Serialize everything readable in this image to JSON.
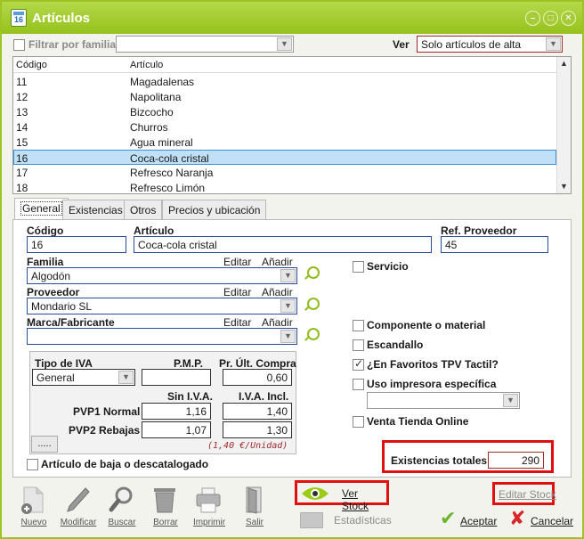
{
  "window": {
    "title": "Artículos",
    "icon_text": "16"
  },
  "filter": {
    "label": "Filtrar por familia",
    "value": "",
    "ver_label": "Ver",
    "ver_value": "Solo artículos de alta"
  },
  "list": {
    "columns": [
      "Código",
      "Artículo"
    ],
    "rows": [
      [
        "11",
        "Magadalenas"
      ],
      [
        "12",
        "Napolitana"
      ],
      [
        "13",
        "Bizcocho"
      ],
      [
        "14",
        "Churros"
      ],
      [
        "15",
        "Agua mineral"
      ],
      [
        "16",
        "Coca-cola cristal"
      ],
      [
        "17",
        "Refresco Naranja"
      ],
      [
        "18",
        "Refresco Limón"
      ]
    ],
    "selected_index": 5
  },
  "tabs": [
    "General",
    "Existencias",
    "Otros",
    "Precios y ubicación"
  ],
  "general": {
    "codigo_label": "Código",
    "codigo": "16",
    "articulo_label": "Artículo",
    "articulo": "Coca-cola cristal",
    "ref_label": "Ref. Proveedor",
    "ref": "45",
    "familia_label": "Familia",
    "familia": "Algodón",
    "proveedor_label": "Proveedor",
    "proveedor": "Mondario SL",
    "marca_label": "Marca/Fabricante",
    "marca": "",
    "editar": "Editar",
    "anadir": "Añadir",
    "servicio": "Servicio",
    "componente": "Componente o material",
    "escandallo": "Escandallo",
    "favoritos": "¿En Favoritos TPV Tactil?",
    "impresora": "Uso impresora específica",
    "venta_online": "Venta Tienda Online",
    "baja": "Artículo de baja o descatalogado",
    "existencias_label": "Existencias totales",
    "existencias": "290",
    "iva": {
      "tipo_label": "Tipo de IVA",
      "tipo": "General",
      "pmp_label": "P.M.P.",
      "pmp": "",
      "ult_compra_label": "Pr. Últ. Compra",
      "ult_compra": "0,60",
      "sin_iva_label": "Sin I.V.A.",
      "con_iva_label": "I.V.A. Incl.",
      "pvp1_label": "PVP1 Normal",
      "pvp1_sin": "1,16",
      "pvp1_con": "1,40",
      "pvp2_label": "PVP2 Rebajas",
      "pvp2_sin": "1,07",
      "pvp2_con": "1,30",
      "unidad": "(1,40 €/Unidad)",
      "dots": "....."
    }
  },
  "toolbar": {
    "nuevo": "Nuevo",
    "modificar": "Modificar",
    "buscar": "Buscar",
    "borrar": "Borrar",
    "imprimir": "Imprimir",
    "salir": "Salir",
    "ver_stock": "Ver Stock",
    "editar_stock": "Editar Stock",
    "estadisticas": "Estadísticas",
    "aceptar": "Aceptar",
    "cancelar": "Cancelar"
  },
  "colors": {
    "accent": "#96c11c",
    "highlight": "#e01010",
    "selection": "#bfe0f6"
  }
}
